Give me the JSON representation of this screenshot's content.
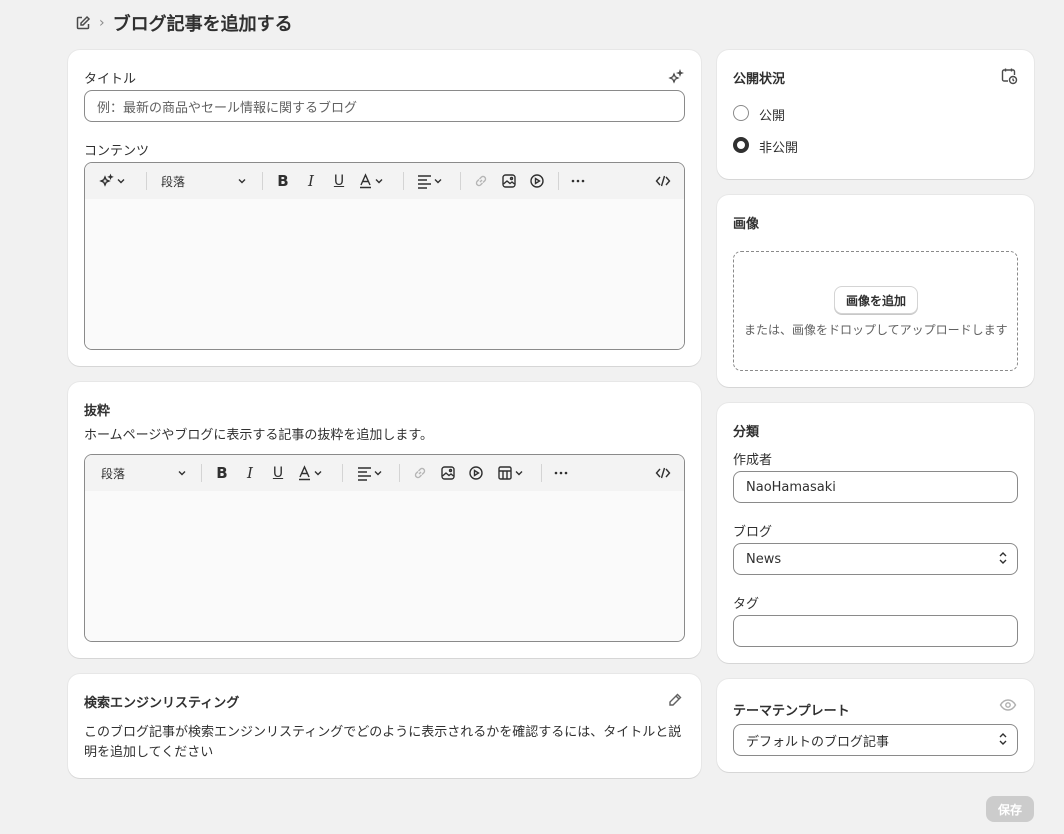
{
  "header": {
    "icon": "edit-icon",
    "separator": "›",
    "title": "ブログ記事を追加する"
  },
  "title_card": {
    "label": "タイトル",
    "placeholder": "例：最新の商品やセール情報に関するブログ",
    "ai_icon": "sparkle-icon",
    "content_label": "コンテンツ",
    "toolbar": {
      "paragraph_label": "段落",
      "icons": [
        "sparkle-icon",
        "chevron-down-icon",
        "bold-icon",
        "italic-icon",
        "underline-icon",
        "text-color-icon",
        "align-icon",
        "link-icon",
        "image-icon",
        "video-icon",
        "more-icon",
        "code-icon"
      ]
    }
  },
  "excerpt_card": {
    "title": "抜粋",
    "description": "ホームページやブログに表示する記事の抜粋を追加します。",
    "toolbar": {
      "paragraph_label": "段落",
      "icons": [
        "bold-icon",
        "italic-icon",
        "underline-icon",
        "text-color-icon",
        "align-icon",
        "link-icon",
        "image-icon",
        "video-icon",
        "table-icon",
        "more-icon",
        "code-icon"
      ]
    }
  },
  "seo_card": {
    "title": "検索エンジンリスティング",
    "edit_icon": "pencil-icon",
    "description": "このブログ記事が検索エンジンリスティングでどのように表示されるかを確認するには、タイトルと説明を追加してください"
  },
  "visibility_card": {
    "title": "公開状況",
    "schedule_icon": "calendar-clock-icon",
    "options": [
      {
        "label": "公開",
        "checked": false
      },
      {
        "label": "非公開",
        "checked": true
      }
    ]
  },
  "image_card": {
    "title": "画像",
    "add_button": "画像を追加",
    "hint": "または、画像をドロップしてアップロードします"
  },
  "organization_card": {
    "title": "分類",
    "author_label": "作成者",
    "author_value": "NaoHamasaki",
    "blog_label": "ブログ",
    "blog_value": "News",
    "tags_label": "タグ",
    "tags_value": ""
  },
  "template_card": {
    "title": "テーマテンプレート",
    "preview_icon": "eye-icon",
    "value": "デフォルトのブログ記事"
  },
  "footer": {
    "save_label": "保存"
  },
  "colors": {
    "background": "#f1f1f1",
    "card": "#ffffff",
    "text": "#303030",
    "muted": "#616161",
    "border": "#8a8a8a",
    "save_disabled": "#cccccc"
  }
}
